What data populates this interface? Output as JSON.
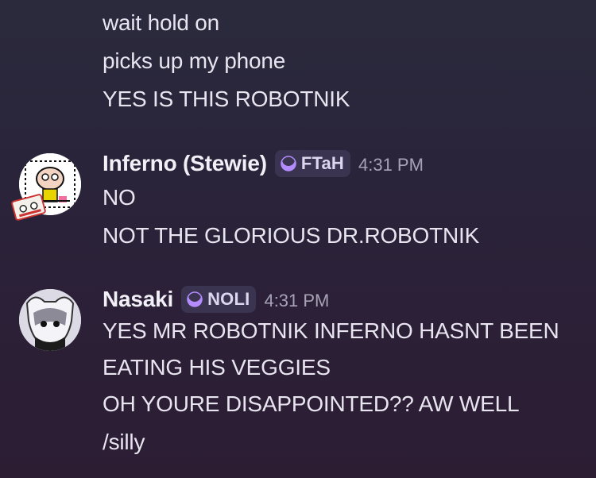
{
  "messages": {
    "continuation": [
      "wait hold on",
      "picks up my phone",
      "YES IS THIS ROBOTNIK"
    ],
    "inferno": {
      "username": "Inferno (Stewie)",
      "role_tag": "FTaH",
      "timestamp": "4:31 PM",
      "lines": [
        "NO",
        "NOT THE GLORIOUS DR.ROBOTNIK"
      ]
    },
    "nasaki": {
      "username": "Nasaki",
      "role_tag": "NOLI",
      "timestamp": "4:31 PM",
      "lines": [
        "YES MR ROBOTNIK INFERNO HASNT BEEN",
        "EATING HIS VEGGIES",
        "OH YOURE DISAPPOINTED?? AW WELL",
        "/silly"
      ]
    }
  },
  "colors": {
    "role_tag_bg": "#3a3450",
    "role_icon": "#b48cff",
    "text": "#e8e5f0",
    "timestamp": "#a7a2b6"
  },
  "icons": {
    "role": "crescent-moon-icon",
    "sticker": "cassette-sticker-icon"
  }
}
